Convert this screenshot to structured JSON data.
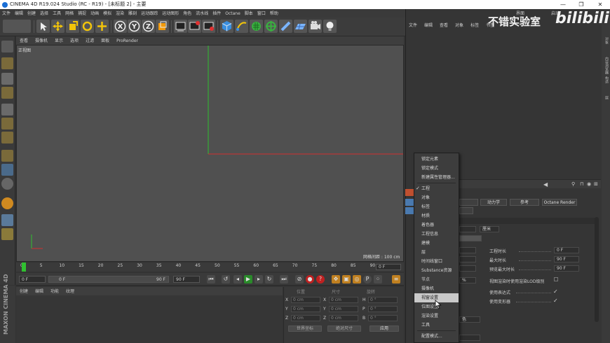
{
  "window": {
    "title": "CINEMA 4D R19.024 Studio (RC - R19) - [未标题 2] - 主要",
    "controls": [
      "—",
      "❐",
      "✕"
    ]
  },
  "menubar": [
    "文件",
    "编辑",
    "创建",
    "选择",
    "工具",
    "网格",
    "捕捉",
    "动画",
    "模拟",
    "渲染",
    "雕刻",
    "运动跟踪",
    "运动图形",
    "角色",
    "流水线",
    "插件",
    "Octane",
    "脚本",
    "窗口",
    "帮助"
  ],
  "top_right_labels": {
    "layout": "界面",
    "startup": "启动"
  },
  "viewport": {
    "menu": [
      "查看",
      "摄像机",
      "显示",
      "选项",
      "过滤",
      "面板",
      "ProRender"
    ],
    "label": "正视图",
    "grid_spacing": "网格间距 : 100 cm"
  },
  "timeline": {
    "ticks": [
      "0",
      "5",
      "10",
      "15",
      "20",
      "25",
      "30",
      "35",
      "40",
      "45",
      "50",
      "55",
      "60",
      "65",
      "70",
      "75",
      "80",
      "85",
      "90"
    ],
    "current_frame": "0 F",
    "start": "0 F",
    "min": "0 F",
    "max": "90 F",
    "end": "90 F"
  },
  "materials": {
    "menu": [
      "创建",
      "编辑",
      "功能",
      "纹理"
    ]
  },
  "maxon_logo": "MAXON CINEMA 4D",
  "coordinates": {
    "header": [
      "位置",
      "尺寸",
      "旋转"
    ],
    "rows": [
      {
        "axis": "X",
        "pos": "0 cm",
        "size": "0 cm",
        "rot_axis": "H",
        "rot": "0 °"
      },
      {
        "axis": "Y",
        "pos": "0 cm",
        "size": "0 cm",
        "rot_axis": "P",
        "rot": "0 °"
      },
      {
        "axis": "Z",
        "pos": "0 cm",
        "size": "0 cm",
        "rot_axis": "B",
        "rot": "0 °"
      }
    ],
    "mode": "世界坐标",
    "scale_mode": "绝对尺寸",
    "apply": "应用"
  },
  "right_panel": {
    "menu": [
      "文件",
      "编辑",
      "查看",
      "对象",
      "标签",
      "书签"
    ],
    "side_tabs": [
      "对象",
      "内容浏览器",
      "构造",
      "层"
    ],
    "attr_tabs": [
      "动力学",
      "参考",
      "Octane Render"
    ],
    "attr_rows": [
      {
        "label": "工程时长",
        "value": "0 F"
      },
      {
        "label": "最大时长",
        "value": "90 F"
      },
      {
        "label": "预览最大时长",
        "value": "90 F"
      }
    ],
    "unit_value": "厘米",
    "percent": "%",
    "lod_label": "视图渲染时使用渲染LOD级别",
    "checks": [
      {
        "label": "使用表达式",
        "value": "✓"
      },
      {
        "label": "使用变形器",
        "value": "✓"
      }
    ],
    "color_label": "色",
    "select_mode": "配置模式..."
  },
  "context_menu": {
    "items": [
      {
        "label": "锁定元素",
        "checked": false,
        "highlight": false
      },
      {
        "label": "锁定模式",
        "checked": false,
        "highlight": false
      },
      {
        "label": "新建属性管理器...",
        "checked": false,
        "highlight": false
      },
      {
        "sep": true
      },
      {
        "label": "工程",
        "checked": true,
        "highlight": false
      },
      {
        "label": "对象",
        "checked": false,
        "highlight": false
      },
      {
        "label": "标签",
        "checked": false,
        "highlight": false
      },
      {
        "label": "材质",
        "checked": false,
        "highlight": false
      },
      {
        "label": "着色器",
        "checked": false,
        "highlight": false
      },
      {
        "label": "工程信息",
        "checked": false,
        "highlight": false
      },
      {
        "label": "建模",
        "checked": false,
        "highlight": false
      },
      {
        "label": "层",
        "checked": false,
        "highlight": false
      },
      {
        "label": "时间线窗口",
        "checked": false,
        "highlight": false
      },
      {
        "label": "Substance资源",
        "checked": false,
        "highlight": false
      },
      {
        "label": "节点",
        "checked": false,
        "highlight": false
      },
      {
        "label": "摄像机",
        "checked": false,
        "highlight": false
      },
      {
        "label": "视窗设置",
        "checked": false,
        "highlight": true
      },
      {
        "label": "位图设置",
        "checked": false,
        "highlight": false
      },
      {
        "label": "渲染设置",
        "checked": false,
        "highlight": false
      },
      {
        "label": "工具",
        "checked": false,
        "highlight": false
      },
      {
        "sep": true
      },
      {
        "label": "配置模式...",
        "checked": false,
        "highlight": false
      }
    ]
  },
  "watermark": {
    "text": "不错实验室",
    "brand": "bilibili"
  },
  "colors": {
    "x_axis": "#d03030",
    "y_axis": "#30c030",
    "viewport_bg": "#505050",
    "accent": "#1a6fd6"
  }
}
